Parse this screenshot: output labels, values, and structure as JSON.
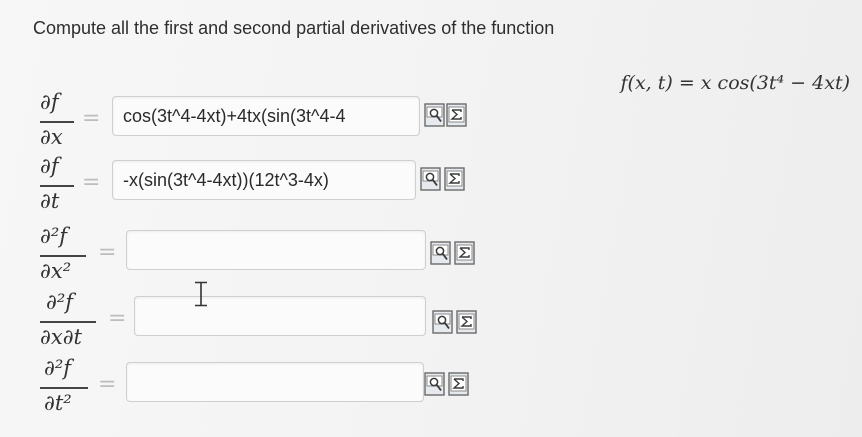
{
  "prompt": "Compute all the first and second partial derivatives of the function",
  "function": "f(x, t) = x cos(3t⁴ − 4xt)",
  "rows": [
    {
      "num": "∂f",
      "den": "∂x",
      "value": "cos(3t^4-4xt)+4tx(sin(3t^4-4"
    },
    {
      "num": "∂f",
      "den": "∂t",
      "value": "-x(sin(3t^4-4xt))(12t^3-4x)"
    },
    {
      "num": "∂²f",
      "den": "∂x²",
      "value": ""
    },
    {
      "num": "∂²f",
      "den": "∂x∂t",
      "value": ""
    },
    {
      "num": "∂²f",
      "den": "∂t²",
      "value": ""
    }
  ],
  "equals": "=",
  "icons": {
    "preview": "preview-icon",
    "equation_editor": "sigma-icon"
  },
  "colors": {
    "field_border": "#cfcfcf",
    "icon_border": "#6a6a6a",
    "equals_sign": "#bdbdbd"
  }
}
